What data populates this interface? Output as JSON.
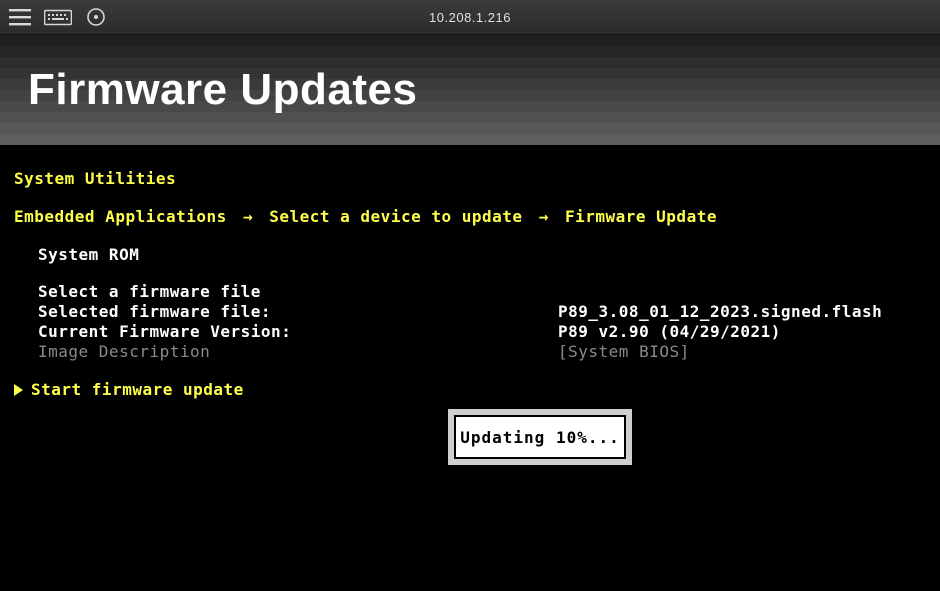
{
  "toolbar": {
    "ip_address": "10.208.1.216"
  },
  "header": {
    "title": "Firmware Updates"
  },
  "section_title": "System Utilities",
  "breadcrumb": {
    "items": [
      "Embedded Applications",
      "Select a device to update",
      "Firmware Update"
    ]
  },
  "rom_title": "System ROM",
  "fields": {
    "select_file_label": "Select a firmware file",
    "selected_label": "Selected firmware file:",
    "selected_value": "P89_3.08_01_12_2023.signed.flash",
    "current_label": "Current Firmware Version:",
    "current_value": "P89 v2.90 (04/29/2021)",
    "desc_label": "Image Description",
    "desc_value": "[System BIOS]"
  },
  "action_label": "Start firmware update",
  "progress": {
    "text": "Updating  10%..."
  }
}
